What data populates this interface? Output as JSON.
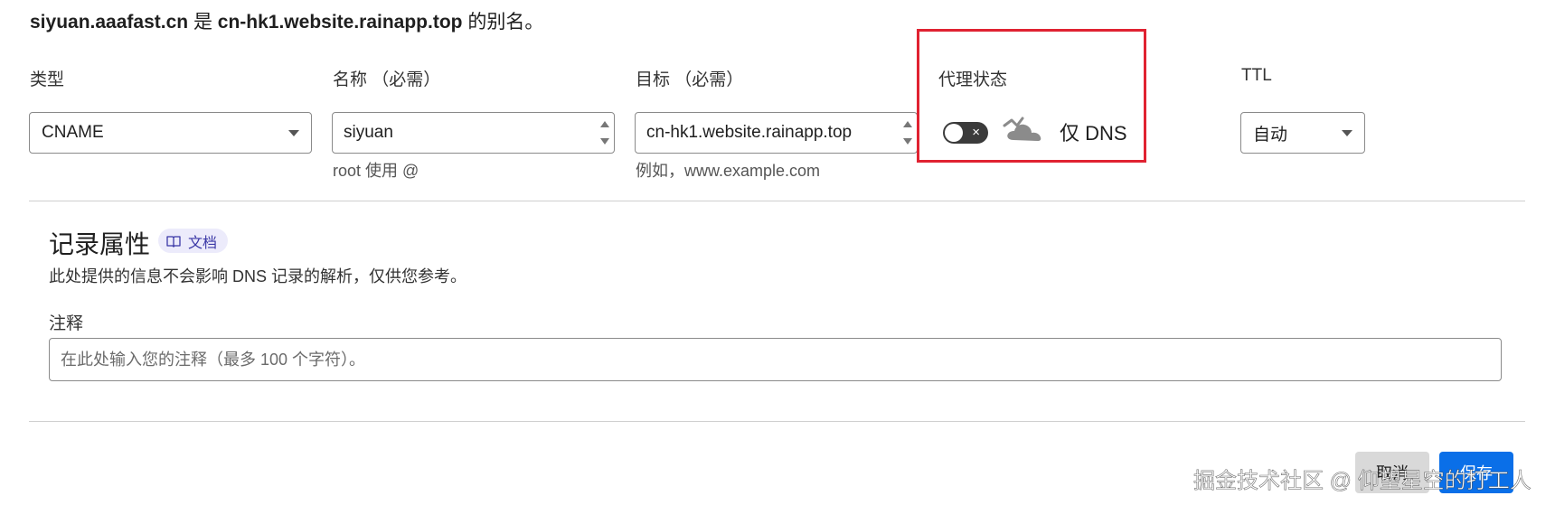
{
  "alias_notice": {
    "name": "siyuan.aaafast.cn",
    "is_word": "是",
    "target": "cn-hk1.website.rainapp.top",
    "suffix": "的别名。"
  },
  "fields": {
    "type": {
      "label": "类型",
      "value": "CNAME"
    },
    "name": {
      "label": "名称 （必需）",
      "value": "siyuan",
      "hint": "root 使用 @"
    },
    "target": {
      "label": "目标 （必需）",
      "value": "cn-hk1.website.rainapp.top",
      "hint": "例如，www.example.com"
    },
    "proxy": {
      "label": "代理状态",
      "status_text": "仅 DNS",
      "toggle_on": false,
      "toggle_symbol": "×"
    },
    "ttl": {
      "label": "TTL",
      "value": "自动"
    }
  },
  "record_properties": {
    "title": "记录属性",
    "doc_badge": "文档",
    "description": "此处提供的信息不会影响 DNS 记录的解析，仅供您参考。",
    "notes_label": "注释",
    "notes_placeholder": "在此处输入您的注释（最多 100 个字符）。",
    "notes_value": ""
  },
  "actions": {
    "cancel_label": "取消",
    "save_label": "保存"
  },
  "watermark": "掘金技术社区 @ 仰望星空的打工人",
  "colors": {
    "highlight_border": "#e02231",
    "save_button": "#0a6fe8",
    "badge_bg": "#ecebfb",
    "badge_text": "#3a37a6",
    "toggle_off": "#3b3b3b"
  }
}
